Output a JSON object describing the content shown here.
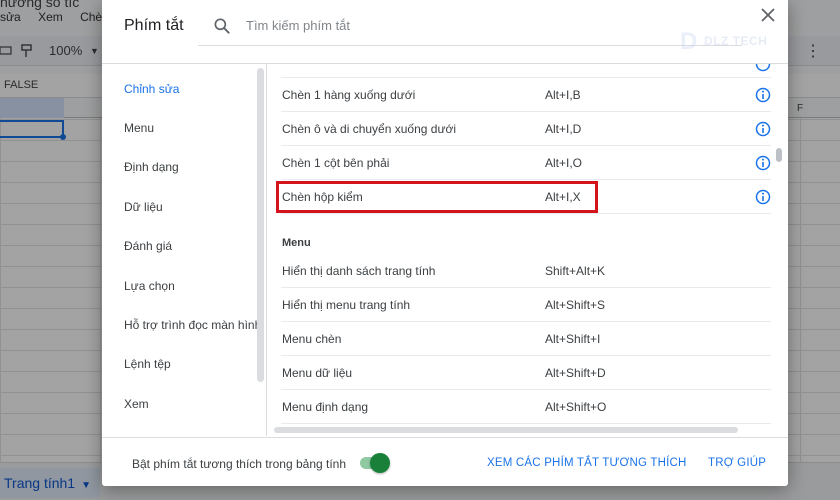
{
  "background": {
    "doc_title": "hướng sổ tíc",
    "menu": [
      "sửa",
      "Xem",
      "Chè"
    ],
    "zoom": "100%",
    "formula_text": "FALSE",
    "column_f": "F",
    "sheet_tab": "Trang tính1"
  },
  "dialog": {
    "title": "Phím tắt",
    "search_placeholder": "Tìm kiếm phím tắt",
    "watermark": "DLZ TECH",
    "categories": [
      {
        "label": "Chỉnh sửa",
        "active": true
      },
      {
        "label": "Menu"
      },
      {
        "label": "Định dạng"
      },
      {
        "label": "Dữ liệu"
      },
      {
        "label": "Đánh giá"
      },
      {
        "label": "Lựa chọn"
      },
      {
        "label": "Hỗ trợ trình đọc màn hình"
      },
      {
        "label": "Lệnh tệp"
      },
      {
        "label": "Xem"
      }
    ],
    "edit_shortcuts": [
      {
        "name": "Chèn 1 hàng xuống dưới",
        "keys": "Alt+I,B"
      },
      {
        "name": "Chèn ô và di chuyển xuống dưới",
        "keys": "Alt+I,D"
      },
      {
        "name": "Chèn 1 cột bên phải",
        "keys": "Alt+I,O"
      },
      {
        "name": "Chèn hộp kiểm",
        "keys": "Alt+I,X",
        "highlighted": true
      }
    ],
    "menu_section_title": "Menu",
    "menu_shortcuts": [
      {
        "name": "Hiển thị danh sách trang tính",
        "keys": "Shift+Alt+K"
      },
      {
        "name": "Hiển thị menu trang tính",
        "keys": "Alt+Shift+S"
      },
      {
        "name": "Menu chèn",
        "keys": "Alt+Shift+I"
      },
      {
        "name": "Menu dữ liệu",
        "keys": "Alt+Shift+D"
      },
      {
        "name": "Menu định dạng",
        "keys": "Alt+Shift+O"
      }
    ],
    "footer": {
      "toggle_label": "Bật phím tắt tương thích trong bảng tính",
      "toggle_on": true,
      "compat_link": "XEM CÁC PHÍM TẮT TƯƠNG THÍCH",
      "help_link": "TRỢ GIÚP"
    },
    "colors": {
      "accent": "#1a73e8",
      "highlight_box": "#d4141c",
      "toggle": "#188038"
    }
  }
}
